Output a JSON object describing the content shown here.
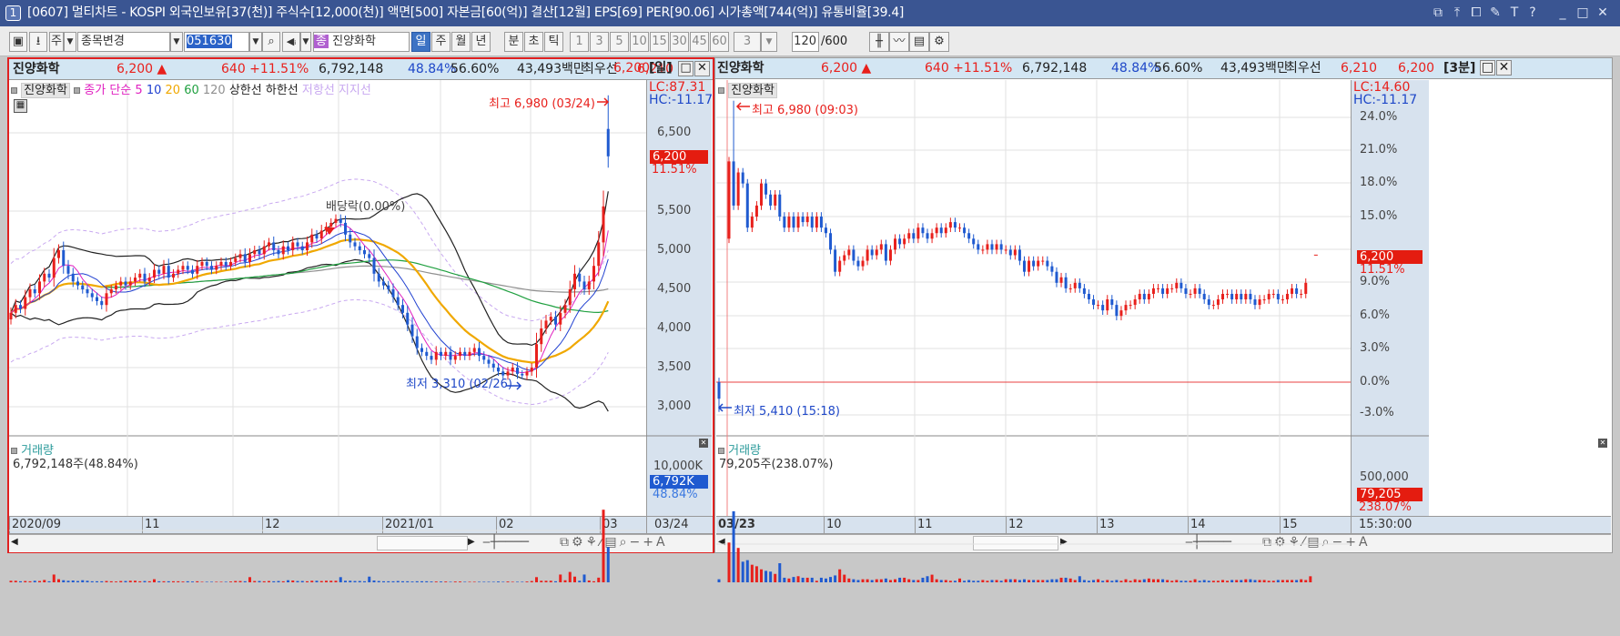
{
  "window": {
    "index": "1",
    "title": "[0607] 멀티차트 - KOSPI 외국인보유[37(천)] 주식수[12,000(천)] 액면[500] 자본금[60(억)] 결산[12월] EPS[69] PER[90.06] 시가총액[744(억)] 유통비율[39.4]",
    "buttons": [
      "restore-icon",
      "pin-top-icon",
      "copy-window-icon",
      "pin-icon",
      "font-icon",
      "help-icon",
      "minimize-icon",
      "maximize-icon",
      "close-icon"
    ]
  },
  "toolbar": {
    "market": "주",
    "change_label": "종목변경",
    "code": "051630",
    "badge": "종",
    "stock_name": "진양화학",
    "periods": [
      "일",
      "주",
      "월",
      "년",
      "분",
      "초",
      "틱"
    ],
    "active_period": "일",
    "intervals": [
      "1",
      "3",
      "5",
      "10",
      "15",
      "30",
      "45",
      "60"
    ],
    "interval_value": "3",
    "count": "120",
    "count_max": "/600"
  },
  "colors": {
    "up": "#e8201c",
    "down": "#1f5ad0",
    "ma5": "#e020c0",
    "ma10": "#2040d0",
    "ma20": "#f0a800",
    "ma60": "#20a040",
    "ma120": "#909090"
  },
  "panels": [
    {
      "info": {
        "name": "진양화학",
        "price": "6,200 ▲",
        "change": "640 +11.51%",
        "volume": "6,792,148",
        "vol_ratio": "48.84%",
        "rate": "56.60%",
        "amount": "43,493백만",
        "best_label": "최우선",
        "ask": "6,210",
        "bid": "6,200",
        "period": "[일]"
      },
      "legend": {
        "name": "진양화학",
        "ma_label": "종가 단순",
        "ma": [
          "5",
          "10",
          "20",
          "60",
          "120"
        ],
        "upper": "상한선",
        "lower": "하한선",
        "resist": "저항선",
        "support": "지지선"
      },
      "lc": "LC:87.31",
      "hc": "HC:-11.17",
      "price_ticks": [
        "6,500",
        "5,500",
        "5,000",
        "4,500",
        "4,000",
        "3,500",
        "3,000"
      ],
      "last_price": "6,200",
      "last_pct": "11.51%",
      "high_note": "최고 6,980 (03/24)",
      "low_note": "최저 3,310 (02/26)",
      "dividend_note": "배당락(0.00%)",
      "volume_title": "거래량",
      "volume_text": "6,792,148주(48.84%)",
      "volume_tick": "10,000K",
      "volume_last": "6,792K",
      "volume_pct": "48.84%",
      "dates": [
        "2020/09",
        "11",
        "12",
        "2021/01",
        "02",
        "03"
      ],
      "axis_date": "03/24"
    },
    {
      "info": {
        "name": "진양화학",
        "price": "6,200 ▲",
        "change": "640 +11.51%",
        "volume": "6,792,148",
        "vol_ratio": "48.84%",
        "rate": "56.60%",
        "amount": "43,493백만",
        "best_label": "최우선",
        "ask": "6,210",
        "bid": "6,200",
        "period": "[3분]"
      },
      "legend": {
        "name": "진양화학"
      },
      "lc": "LC:14.60",
      "hc": "HC:-11.17",
      "pct_ticks": [
        "24.0%",
        "21.0%",
        "18.0%",
        "15.0%",
        "9.0%",
        "6.0%",
        "3.0%",
        "0.0%",
        "-3.0%"
      ],
      "last_price": "6,200",
      "last_pct": "11.51%",
      "high_note": "최고 6,980 (09:03)",
      "low_note": "최저 5,410 (15:18)",
      "volume_title": "거래량",
      "volume_text": "79,205주(238.07%)",
      "volume_tick": "500,000",
      "volume_last": "79,205",
      "volume_pct": "238.07%",
      "dates": [
        "03/23",
        "10",
        "11",
        "12",
        "13",
        "14",
        "15"
      ],
      "axis_date": "15:30:00"
    }
  ],
  "chart_data": [
    {
      "type": "candlestick",
      "interval": "daily",
      "y_unit": "KRW",
      "ylim": [
        2850,
        7050
      ],
      "high": {
        "value": 6980,
        "date": "03/24"
      },
      "low": {
        "value": 3310,
        "date": "02/26"
      },
      "last_open": 6550,
      "closes": [
        4200,
        4300,
        4250,
        4400,
        4500,
        4450,
        4600,
        4700,
        4650,
        4900,
        5000,
        4800,
        4700,
        4600,
        4550,
        4500,
        4450,
        4400,
        4350,
        4300,
        4450,
        4500,
        4550,
        4600,
        4550,
        4600,
        4650,
        4700,
        4600,
        4650,
        4750,
        4700,
        4800,
        4650,
        4700,
        4750,
        4800,
        4750,
        4700,
        4800,
        4850,
        4800,
        4750,
        4800,
        4850,
        4800,
        4850,
        4900,
        4950,
        4850,
        4950,
        5000,
        4950,
        5050,
        5100,
        5000,
        4950,
        5050,
        5000,
        5100,
        5050,
        5000,
        5100,
        5200,
        5150,
        5250,
        5300,
        5350,
        5400,
        5350,
        5200,
        5100,
        5050,
        5000,
        4950,
        4900,
        4700,
        4600,
        4550,
        4500,
        4400,
        4300,
        4200,
        4050,
        3900,
        3750,
        3700,
        3650,
        3600,
        3700,
        3650,
        3700,
        3600,
        3650,
        3700,
        3650,
        3700,
        3750,
        3650,
        3600,
        3550,
        3500,
        3450,
        3400,
        3450,
        3500,
        3420,
        3400,
        3450,
        3500,
        3800,
        4000,
        4100,
        4150,
        4050,
        4200,
        4300,
        4500,
        4700,
        4600,
        4500,
        4600,
        4800,
        5100,
        5560,
        6200
      ],
      "volume_k": [
        300,
        300,
        200,
        250,
        200,
        300,
        250,
        450,
        200,
        1500,
        600,
        400,
        300,
        350,
        250,
        400,
        300,
        200,
        200,
        200,
        250,
        200,
        150,
        250,
        250,
        300,
        300,
        200,
        250,
        200,
        600,
        200,
        200,
        200,
        200,
        200,
        150,
        200,
        150,
        200,
        100,
        100,
        100,
        100,
        100,
        100,
        150,
        250,
        250,
        200,
        1000,
        250,
        250,
        200,
        250,
        200,
        250,
        200,
        400,
        350,
        250,
        250,
        200,
        300,
        300,
        250,
        300,
        300,
        300,
        1000,
        300,
        300,
        250,
        250,
        200,
        1100,
        350,
        250,
        200,
        200,
        200,
        250,
        200,
        200,
        150,
        200,
        200,
        200,
        150,
        150,
        150,
        150,
        100,
        150,
        150,
        100,
        100,
        100,
        100,
        100,
        100,
        100,
        150,
        100,
        150,
        100,
        100,
        100,
        150,
        250,
        1000,
        300,
        300,
        300,
        200,
        1500,
        400,
        2000,
        1100,
        300,
        1500,
        350,
        200,
        900,
        14000,
        6792
      ]
    },
    {
      "type": "candlestick",
      "interval": "3min",
      "y_unit": "% vs prev close",
      "ylim": [
        -4.8,
        27
      ],
      "high": {
        "value": 25.5,
        "time": "09:03"
      },
      "low": {
        "value": -2.7,
        "time": "15:18"
      },
      "closes": [
        -1.5,
        20,
        16,
        19,
        18,
        14,
        15,
        16,
        18,
        17,
        16,
        17,
        15,
        14,
        15,
        14,
        15,
        14.5,
        15,
        14,
        15,
        14,
        13.5,
        12,
        10,
        11,
        11.5,
        12,
        11,
        10.5,
        11,
        12,
        11.5,
        12,
        12.5,
        11,
        12,
        13,
        12.5,
        13,
        13.5,
        13,
        14,
        13.5,
        13,
        13.5,
        14,
        13.5,
        14,
        14.5,
        14,
        14,
        13.5,
        13,
        12.5,
        12,
        12,
        12.5,
        12,
        12.5,
        12,
        12,
        11.5,
        12,
        11,
        10,
        11,
        10.5,
        11,
        11,
        10.5,
        10,
        9,
        9.5,
        8.5,
        8.5,
        9,
        8.5,
        8,
        7.5,
        7,
        7,
        6.5,
        7.5,
        7,
        6,
        6.5,
        7,
        7,
        7.5,
        8,
        7.5,
        8,
        8.5,
        8.5,
        8,
        8.5,
        8.5,
        9,
        8.5,
        8,
        8,
        8.5,
        8,
        7.5,
        7,
        7,
        7.5,
        8,
        8,
        7.5,
        8,
        7.5,
        8,
        7.5,
        7,
        7.5,
        7.5,
        8,
        8,
        7.5,
        7.5,
        8,
        8.5,
        8,
        8,
        9,
        11.51
      ],
      "volume": [
        40000,
        520000,
        930000,
        450000,
        270000,
        290000,
        230000,
        210000,
        170000,
        150000,
        140000,
        110000,
        250000,
        60000,
        50000,
        70000,
        80000,
        60000,
        60000,
        60000,
        20000,
        60000,
        50000,
        70000,
        90000,
        170000,
        100000,
        50000,
        40000,
        30000,
        40000,
        40000,
        30000,
        40000,
        40000,
        50000,
        30000,
        40000,
        60000,
        60000,
        40000,
        30000,
        30000,
        60000,
        80000,
        100000,
        40000,
        30000,
        30000,
        20000,
        20000,
        50000,
        20000,
        30000,
        20000,
        20000,
        30000,
        20000,
        30000,
        30000,
        20000,
        40000,
        40000,
        40000,
        30000,
        40000,
        30000,
        30000,
        30000,
        30000,
        30000,
        40000,
        40000,
        60000,
        60000,
        50000,
        30000,
        80000,
        30000,
        20000,
        30000,
        40000,
        20000,
        30000,
        20000,
        30000,
        20000,
        40000,
        20000,
        40000,
        30000,
        40000,
        50000,
        40000,
        40000,
        40000,
        30000,
        20000,
        30000,
        20000,
        20000,
        20000,
        40000,
        20000,
        30000,
        20000,
        20000,
        20000,
        30000,
        20000,
        30000,
        30000,
        30000,
        40000,
        40000,
        30000,
        30000,
        30000,
        20000,
        20000,
        30000,
        30000,
        30000,
        30000,
        30000,
        40000,
        30000,
        79205
      ]
    }
  ]
}
